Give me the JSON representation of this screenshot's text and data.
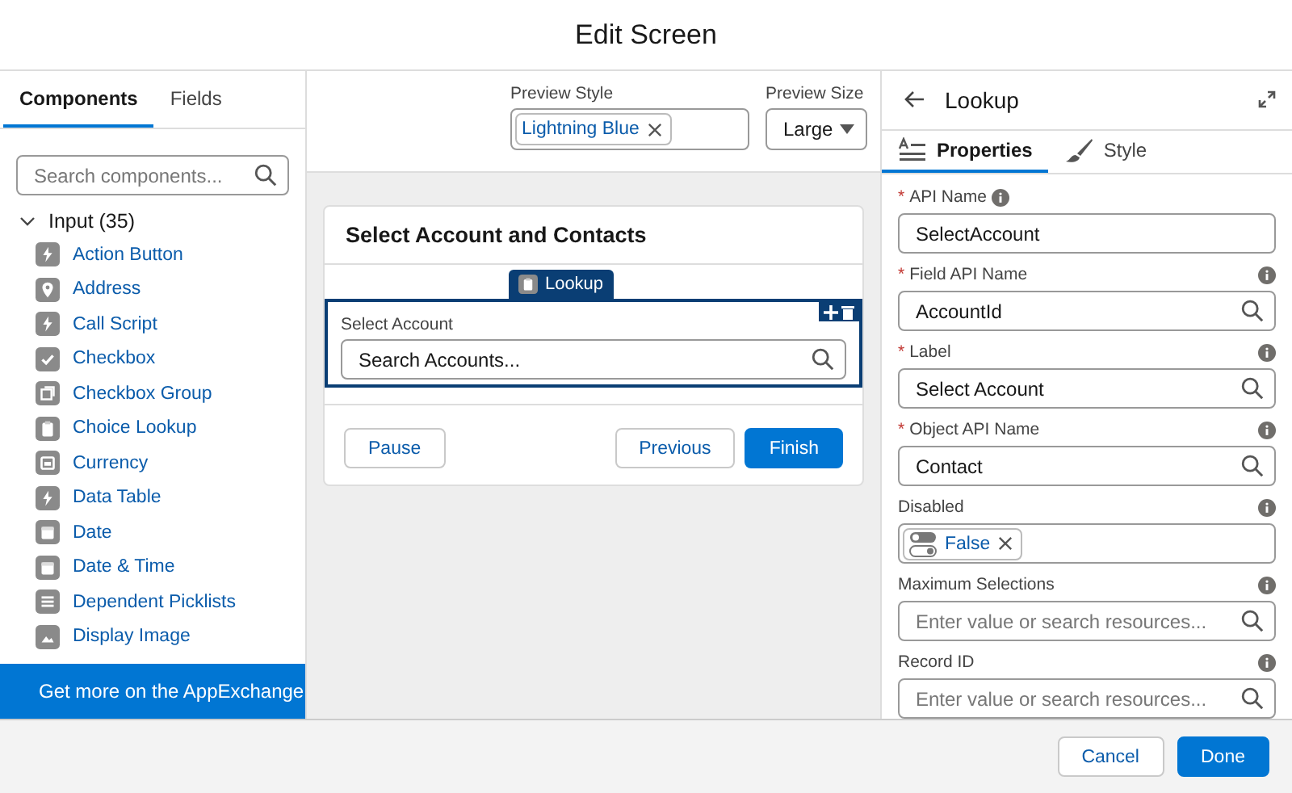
{
  "window": {
    "title": "Edit Screen"
  },
  "left_panel": {
    "tabs": [
      {
        "label": "Components",
        "selected": true
      },
      {
        "label": "Fields",
        "selected": false
      }
    ],
    "search": {
      "placeholder": "Search components..."
    },
    "section": {
      "label": "Input (35)",
      "expanded": true
    },
    "items": [
      {
        "label": "Action Button",
        "kind": "bolt"
      },
      {
        "label": "Address",
        "kind": "pin"
      },
      {
        "label": "Call Script",
        "kind": "bolt"
      },
      {
        "label": "Checkbox",
        "kind": "check"
      },
      {
        "label": "Checkbox Group",
        "kind": "checkgroup"
      },
      {
        "label": "Choice Lookup",
        "kind": "clipboard"
      },
      {
        "label": "Currency",
        "kind": "box"
      },
      {
        "label": "Data Table",
        "kind": "bolt"
      },
      {
        "label": "Date",
        "kind": "calendar"
      },
      {
        "label": "Date & Time",
        "kind": "calendar"
      },
      {
        "label": "Dependent Picklists",
        "kind": "list"
      },
      {
        "label": "Display Image",
        "kind": "image"
      }
    ],
    "footer_link": "Get more on the AppExchange"
  },
  "preview_options": {
    "style": {
      "label": "Preview Style",
      "value": "Lightning Blue"
    },
    "size": {
      "label": "Preview Size",
      "value": "Large"
    }
  },
  "screen": {
    "title": "Select Account and Contacts",
    "selected_component": {
      "badge": "Lookup",
      "label": "Select Account",
      "placeholder": "Search Accounts..."
    },
    "buttons_left": [
      {
        "label": "Pause",
        "kind": "neutral"
      }
    ],
    "buttons_right": [
      {
        "label": "Previous",
        "kind": "neutral"
      },
      {
        "label": "Finish",
        "kind": "brand"
      }
    ]
  },
  "properties_panel": {
    "title": "Lookup",
    "tabs": [
      {
        "label": "Properties",
        "selected": true
      },
      {
        "label": "Style",
        "selected": false
      }
    ],
    "fields": [
      {
        "required_marker": "*",
        "label": "API Name",
        "kind": "text",
        "value": "SelectAccount"
      },
      {
        "required_marker": "*",
        "label": "Field API Name",
        "kind": "lookup",
        "value": "AccountId"
      },
      {
        "required_marker": "*",
        "label": "Label",
        "kind": "lookup",
        "value": "Select Account"
      },
      {
        "required_marker": "*",
        "label": "Object API Name",
        "kind": "lookup",
        "value": "Contact"
      },
      {
        "label": "Disabled",
        "kind": "pill",
        "value": "False"
      },
      {
        "label": "Maximum Selections",
        "kind": "lookup",
        "placeholder": "Enter value or search resources..."
      },
      {
        "label": "Record ID",
        "kind": "lookup",
        "placeholder": "Enter value or search resources..."
      }
    ]
  },
  "footer": {
    "buttons": [
      {
        "label": "Cancel",
        "kind": "neutral"
      },
      {
        "label": "Done",
        "kind": "brand"
      }
    ]
  }
}
